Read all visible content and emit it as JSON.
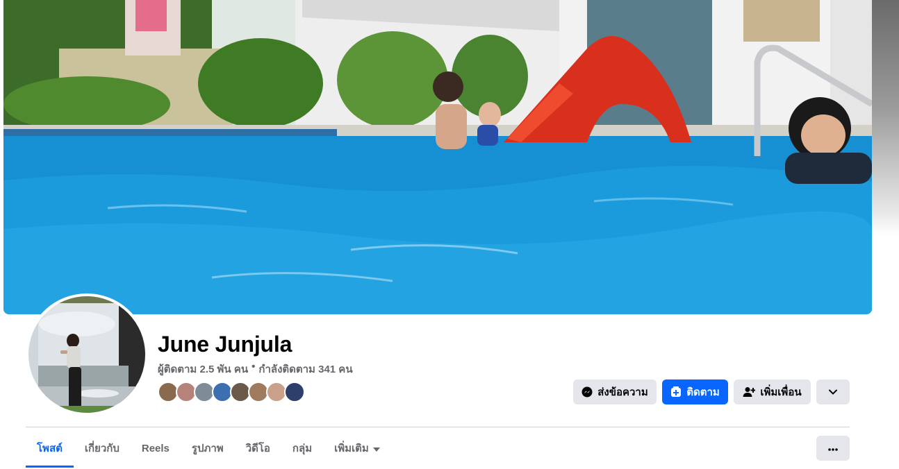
{
  "profile": {
    "name": "June Junjula",
    "followers": "ผู้ติดตาม 2.5 พัน คน",
    "separator": "•",
    "following": "กำลังติดตาม 341 คน",
    "friend_avatar_colors": [
      "#8a6a4f",
      "#b5837a",
      "#7d8c96",
      "#3b6fb0",
      "#6b5a4a",
      "#a07a5c",
      "#c9a089",
      "#2f3f6b"
    ]
  },
  "actions": {
    "message_label": "ส่งข้อความ",
    "follow_label": "ติดตาม",
    "add_friend_label": "เพิ่มเพื่อน"
  },
  "tabs": {
    "items": [
      "โพสต์",
      "เกี่ยวกับ",
      "Reels",
      "รูปภาพ",
      "วิดีโอ",
      "กลุ่ม"
    ],
    "more_label": "เพิ่มเติม"
  },
  "colors": {
    "accent": "#0866ff",
    "button_grey": "#e4e6eb",
    "secondary_text": "#65676b"
  },
  "icons": {
    "message": "messenger-icon",
    "follow": "follow-plus-icon",
    "add_friend": "add-friend-icon",
    "expand": "chevron-down-icon",
    "more": "more-dots-icon"
  }
}
